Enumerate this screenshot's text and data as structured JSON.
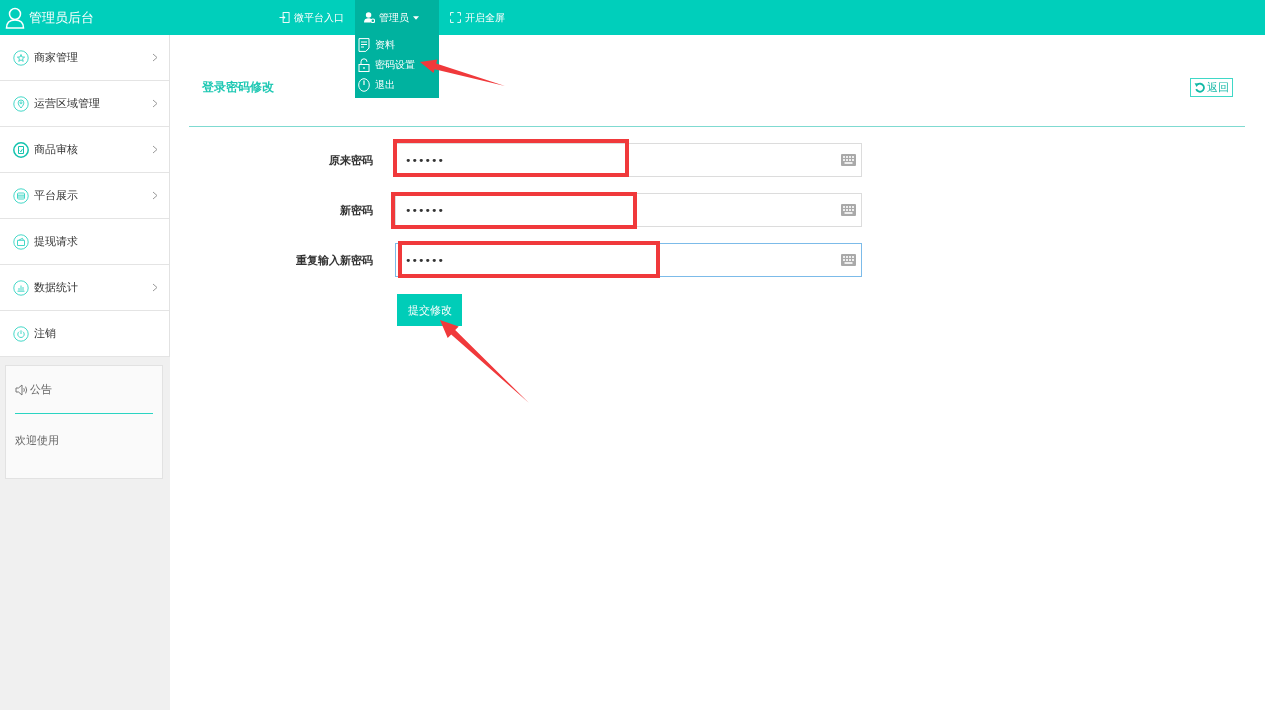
{
  "header": {
    "title": "管理员后台",
    "nav": [
      {
        "kind": "link",
        "label": "微平台入口",
        "expanded": false
      },
      {
        "kind": "dropdown",
        "label": "管理员",
        "expanded": true,
        "menu": [
          {
            "label": "资料",
            "arrow": false
          },
          {
            "label": "密码设置",
            "arrow": true
          },
          {
            "label": "退出",
            "arrow": false
          }
        ]
      },
      {
        "kind": "link",
        "label": "开启全屏",
        "expanded": false
      }
    ]
  },
  "sidebar": {
    "items": [
      {
        "label": "商家管理",
        "has_submenu": true
      },
      {
        "label": "运营区域管理",
        "has_submenu": true
      },
      {
        "label": "商品审核",
        "has_submenu": true
      },
      {
        "label": "平台展示",
        "has_submenu": true
      },
      {
        "label": "提现请求",
        "has_submenu": false
      },
      {
        "label": "数据统计",
        "has_submenu": true
      },
      {
        "label": "注销",
        "has_submenu": false
      }
    ],
    "notice": {
      "title": "公告",
      "body": "欢迎使用"
    }
  },
  "main": {
    "title": "登录密码修改",
    "back_button": "返回",
    "form": {
      "fields": [
        {
          "label": "原来密码",
          "value": "••••••",
          "focused": false,
          "highlighted": true
        },
        {
          "label": "新密码",
          "value": "••••••",
          "focused": false,
          "highlighted": true
        },
        {
          "label": "重复输入新密码",
          "value": "••••••",
          "focused": true,
          "highlighted": true
        }
      ],
      "submit": {
        "label": "提交修改",
        "arrow": true
      }
    }
  }
}
